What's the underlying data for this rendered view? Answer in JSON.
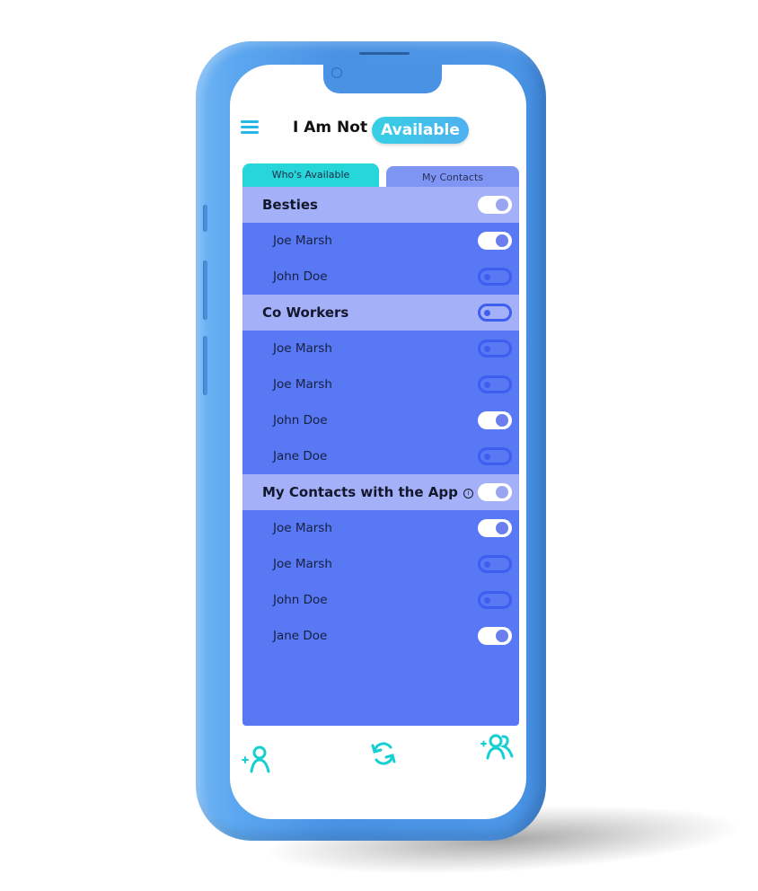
{
  "header": {
    "title": "I Am Not",
    "status_pill": "Available",
    "menu_icon": "hamburger-menu-icon"
  },
  "tabs": [
    {
      "label": "Who's Available",
      "active": true
    },
    {
      "label": "My Contacts",
      "active": false
    }
  ],
  "groups": [
    {
      "name": "Besties",
      "enabled": true,
      "info": false,
      "contacts": [
        {
          "name": "Joe Marsh",
          "enabled": true
        },
        {
          "name": "John Doe",
          "enabled": false
        }
      ]
    },
    {
      "name": "Co Workers",
      "enabled": false,
      "info": false,
      "contacts": [
        {
          "name": "Joe Marsh",
          "enabled": false
        },
        {
          "name": "Joe Marsh",
          "enabled": false
        },
        {
          "name": "John Doe",
          "enabled": true
        },
        {
          "name": "Jane Doe",
          "enabled": false
        }
      ]
    },
    {
      "name": "My Contacts with the App",
      "enabled": true,
      "info": true,
      "contacts": [
        {
          "name": "Joe Marsh",
          "enabled": true
        },
        {
          "name": "Joe Marsh",
          "enabled": false
        },
        {
          "name": "John Doe",
          "enabled": false
        },
        {
          "name": "Jane Doe",
          "enabled": true
        }
      ]
    }
  ],
  "bottom_bar": {
    "left": "add-user-icon",
    "center": "refresh-icon",
    "right": "add-group-icon"
  },
  "colors": {
    "accent": "#27d6d8",
    "panel": "#5878f4",
    "group_row": "#a4b1f8",
    "phone_frame": "#4a92e4"
  }
}
